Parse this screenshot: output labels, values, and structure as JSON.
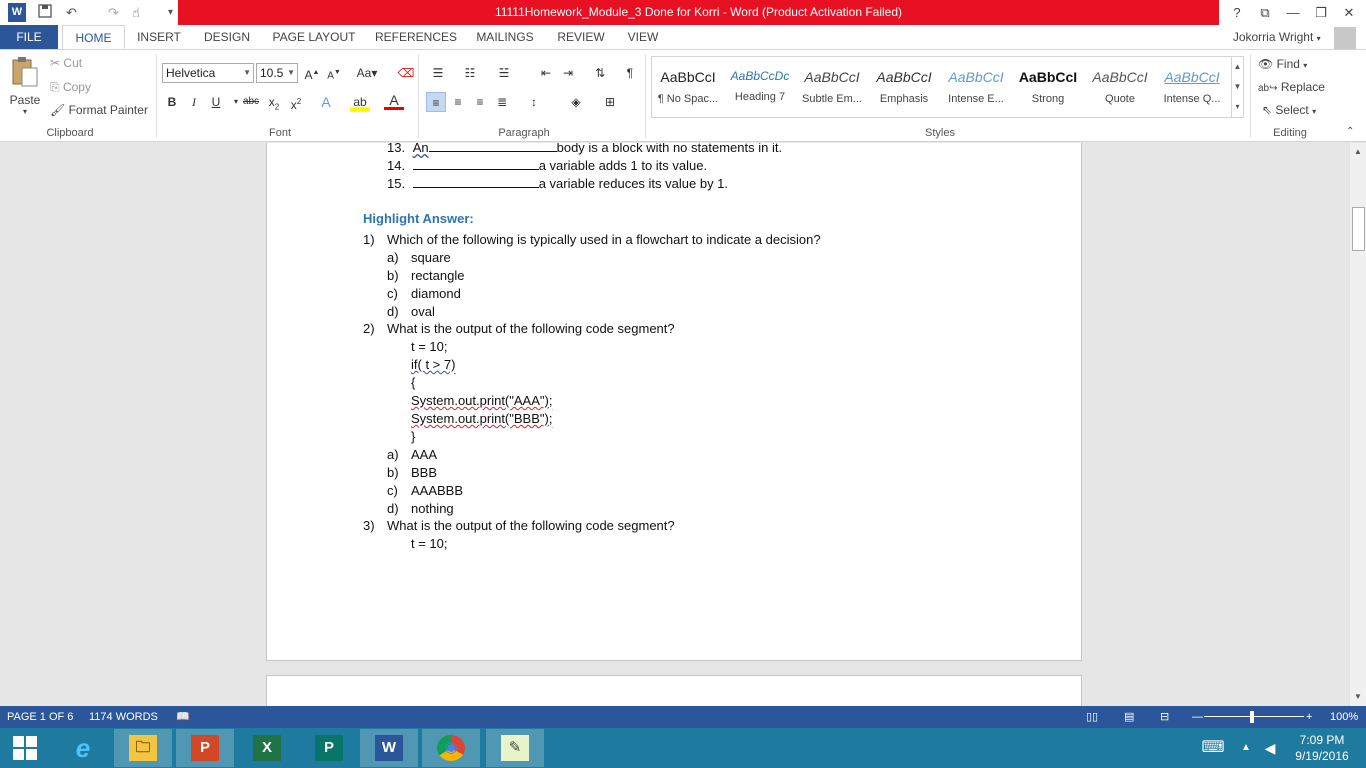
{
  "window": {
    "title": "11111Homework_Module_3 Done for Korri -  Word (Product Activation Failed)",
    "help": "?",
    "ribbon_options": "⧉",
    "minimize": "—",
    "restore": "❐",
    "close": "✕"
  },
  "qat": {
    "undo": "↶",
    "redo": "↷",
    "more": "▾"
  },
  "tabs": [
    "FILE",
    "HOME",
    "INSERT",
    "DESIGN",
    "PAGE LAYOUT",
    "REFERENCES",
    "MAILINGS",
    "REVIEW",
    "VIEW"
  ],
  "user": "Jokorria Wright",
  "clipboard": {
    "paste": "Paste",
    "cut": "Cut",
    "copy": "Copy",
    "format_painter": "Format Painter",
    "label": "Clipboard"
  },
  "font": {
    "family": "Helvetica",
    "size": "10.5",
    "label": "Font"
  },
  "paragraph": {
    "label": "Paragraph"
  },
  "styles": {
    "label": "Styles",
    "items": [
      {
        "sample": "AaBbCcI",
        "name": "¶ No Spac..."
      },
      {
        "sample": "AaBbCcDc",
        "name": "Heading 7"
      },
      {
        "sample": "AaBbCcI",
        "name": "Subtle Em..."
      },
      {
        "sample": "AaBbCcI",
        "name": "Emphasis"
      },
      {
        "sample": "AaBbCcI",
        "name": "Intense E..."
      },
      {
        "sample": "AaBbCcI",
        "name": "Strong"
      },
      {
        "sample": "AaBbCcI",
        "name": "Quote"
      },
      {
        "sample": "AaBbCcI",
        "name": "Intense Q..."
      }
    ],
    "colors": [
      "#222222",
      "#2e74b5",
      "#444444",
      "#333333",
      "#5b9bd5",
      "#111111",
      "#555555",
      "#5b9bd5"
    ]
  },
  "editing": {
    "find": "Find",
    "replace": "Replace",
    "select": "Select",
    "label": "Editing"
  },
  "document": {
    "list": [
      {
        "num": "13.",
        "pre": "An",
        "post": "body is a block with no statements in it."
      },
      {
        "num": "14.",
        "pre": "",
        "post": "a variable adds 1 to its value."
      },
      {
        "num": "15.",
        "pre": "",
        "post": "a variable reduces its value by 1."
      }
    ],
    "heading": "Highlight Answer:",
    "q1": {
      "num": "1)",
      "text": "Which of the following is typically used in a flowchart to indicate a decision?"
    },
    "q1_options": [
      {
        "label": "a)",
        "text": "square"
      },
      {
        "label": "b)",
        "text": "rectangle"
      },
      {
        "label": "c)",
        "text": "diamond"
      },
      {
        "label": "d)",
        "text": "oval"
      }
    ],
    "q2": {
      "num": "2)",
      "text": "What is the output of the following code segment?"
    },
    "code": [
      "t = 10;",
      "if( t > 7)",
      "{",
      "System.out.print(\"AAA\");",
      "System.out.print(\"BBB\");",
      "}"
    ],
    "q2_options": [
      {
        "label": "a)",
        "text": "AAA"
      },
      {
        "label": "b)",
        "text": "BBB"
      },
      {
        "label": "c)",
        "text": "AAABBB"
      },
      {
        "label": "d)",
        "text": "nothing"
      }
    ],
    "q3": {
      "num": "3)",
      "text": "What is the output of the following code segment?"
    },
    "code3": [
      "t = 10;"
    ]
  },
  "status": {
    "page": "PAGE 1 OF 6",
    "words": "1174 WORDS",
    "zoom": "100%"
  },
  "taskbar": {
    "apps": [
      "e",
      "🗀",
      "P",
      "X",
      "P",
      "W",
      "◉",
      "✎"
    ],
    "time": "7:09 PM",
    "date": "9/19/2016"
  }
}
